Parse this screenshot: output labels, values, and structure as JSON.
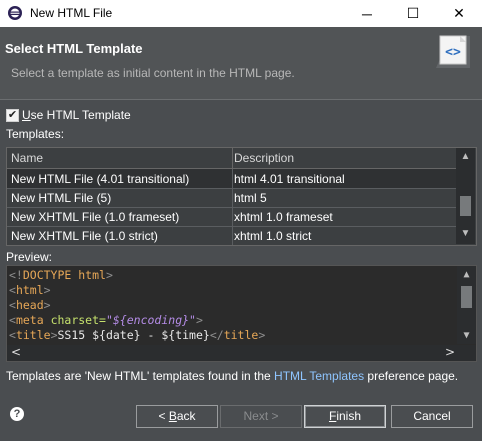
{
  "window": {
    "title": "New HTML File",
    "controls": {
      "minimize": "─",
      "maximize": "☐",
      "close": "✕"
    },
    "icon": "eclipse-icon"
  },
  "header": {
    "title": "Select HTML Template",
    "description": "Select a template as initial content in the HTML page.",
    "icon": "html-file-icon"
  },
  "options": {
    "use_template": {
      "checked": true,
      "label_u": "U",
      "label_rest": "se HTML Template"
    },
    "templates_label": "Templates:"
  },
  "table": {
    "columns": [
      "Name",
      "Description"
    ],
    "rows": [
      {
        "name": "New HTML File (4.01 transitional)",
        "description": "html 4.01 transitional",
        "selected": true
      },
      {
        "name": "New HTML File (5)",
        "description": "html 5",
        "selected": false
      },
      {
        "name": "New XHTML File (1.0 frameset)",
        "description": "xhtml 1.0 frameset",
        "selected": false
      },
      {
        "name": "New XHTML File (1.0 strict)",
        "description": "xhtml 1.0 strict",
        "selected": false
      }
    ]
  },
  "preview": {
    "label": "Preview:",
    "lines": {
      "l1_open": "<!",
      "l1_tag": "DOCTYPE",
      "l1_rest": " html",
      "l1_close": ">",
      "l2_open": "<",
      "l2_tag": "html",
      "l2_close": ">",
      "l3_open": "<",
      "l3_tag": "head",
      "l3_close": ">",
      "l4_open": "<",
      "l4_tag": "meta",
      "l4_attr": " charset=",
      "l4_val": "\"${encoding}\"",
      "l4_close": ">",
      "l5_open": "<",
      "l5_tag": "title",
      "l5_close": ">",
      "l5_text": "SS15 ${date} - ${time}",
      "l5_end_open": "</",
      "l5_end_tag": "title",
      "l5_end_close": ">"
    }
  },
  "footer": {
    "text_before": "Templates are 'New HTML' templates found in the ",
    "link": "HTML Templates",
    "text_after": " preference page."
  },
  "buttons": {
    "back_prefix": "< ",
    "back_u": "B",
    "back_rest": "ack",
    "next_label": "Next >",
    "finish_u": "F",
    "finish_rest": "inish",
    "cancel_label": "Cancel",
    "help": "?"
  },
  "colors": {
    "background": "#4a4d50",
    "code_tag": "#e6a757",
    "code_attr": "#c6e26d",
    "code_value": "#b48ce6",
    "link": "#8fc5ff"
  }
}
